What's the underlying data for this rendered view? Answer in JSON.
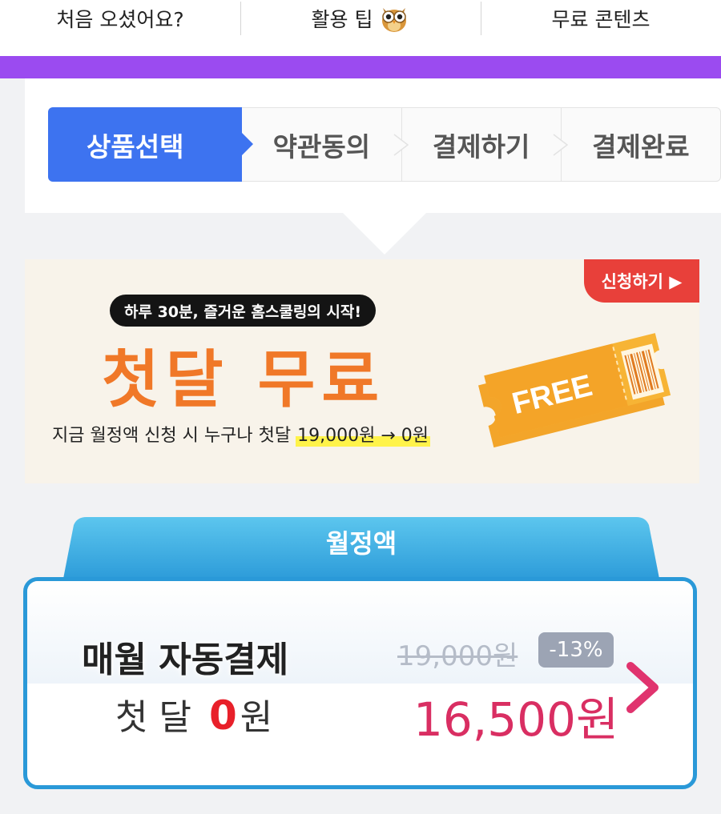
{
  "topnav": {
    "items": [
      {
        "label": "처음 오셨어요?"
      },
      {
        "label": "활용 팁",
        "icon": "owl-icon"
      },
      {
        "label": "무료 콘텐츠"
      }
    ]
  },
  "colors": {
    "accent_purple": "#9b4bf0",
    "step_active": "#3d73f0",
    "banner_orange": "#f07828",
    "apply_red": "#e8403a",
    "plan_blue": "#2a99d8",
    "price_pink": "#d92e62"
  },
  "steps": [
    {
      "label": "상품선택",
      "active": true
    },
    {
      "label": "약관동의",
      "active": false
    },
    {
      "label": "결제하기",
      "active": false
    },
    {
      "label": "결제완료",
      "active": false
    }
  ],
  "banner": {
    "apply_label": "신청하기 ▶",
    "tagline": "하루 30분, 즐거운 홈스쿨링의 시작!",
    "headline": "첫달 무료",
    "subline_prefix": "지금 월정액 신청 시 누구나 첫달",
    "subline_highlight": "19,000원 → 0원",
    "ticket_text": "FREE"
  },
  "plan": {
    "tab_label": "월정액",
    "name": "매월 자동결제",
    "first_month_prefix": "첫 달",
    "first_month_amount": "0",
    "first_month_unit": "원",
    "original_price": "19,000원",
    "discount": "-13%",
    "sale_price": "16,500원"
  }
}
